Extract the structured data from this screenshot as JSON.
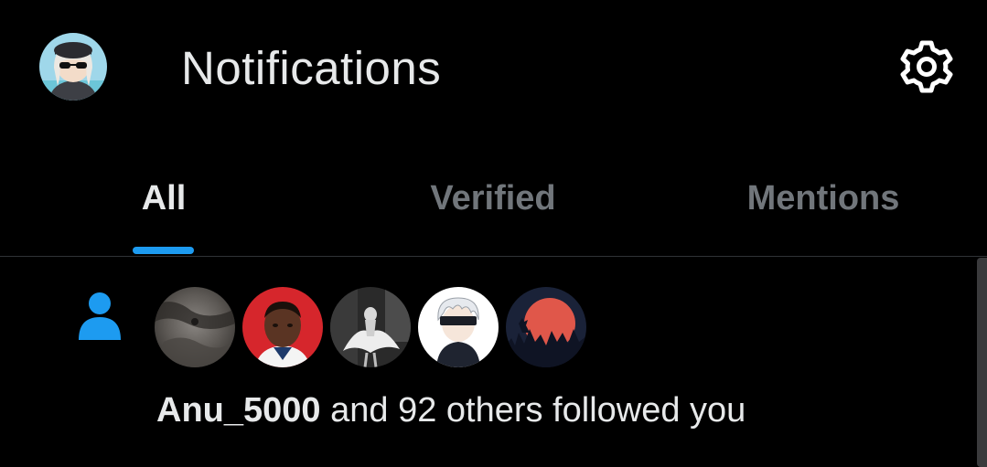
{
  "header": {
    "title": "Notifications",
    "avatar_icon": "profile-avatar",
    "settings_icon": "gear-icon"
  },
  "tabs": [
    {
      "label": "All",
      "active": true
    },
    {
      "label": "Verified",
      "active": false
    },
    {
      "label": "Mentions",
      "active": false
    }
  ],
  "notification": {
    "type_icon": "person-icon",
    "user": "Anu_5000",
    "text": " and 92 others followed you",
    "avatars": [
      "avatar-1",
      "avatar-2",
      "avatar-3",
      "avatar-4",
      "avatar-5"
    ]
  },
  "colors": {
    "accent": "#1d9bf0",
    "background": "#000000",
    "text_primary": "#e7e9ea",
    "text_secondary": "#71767b"
  }
}
